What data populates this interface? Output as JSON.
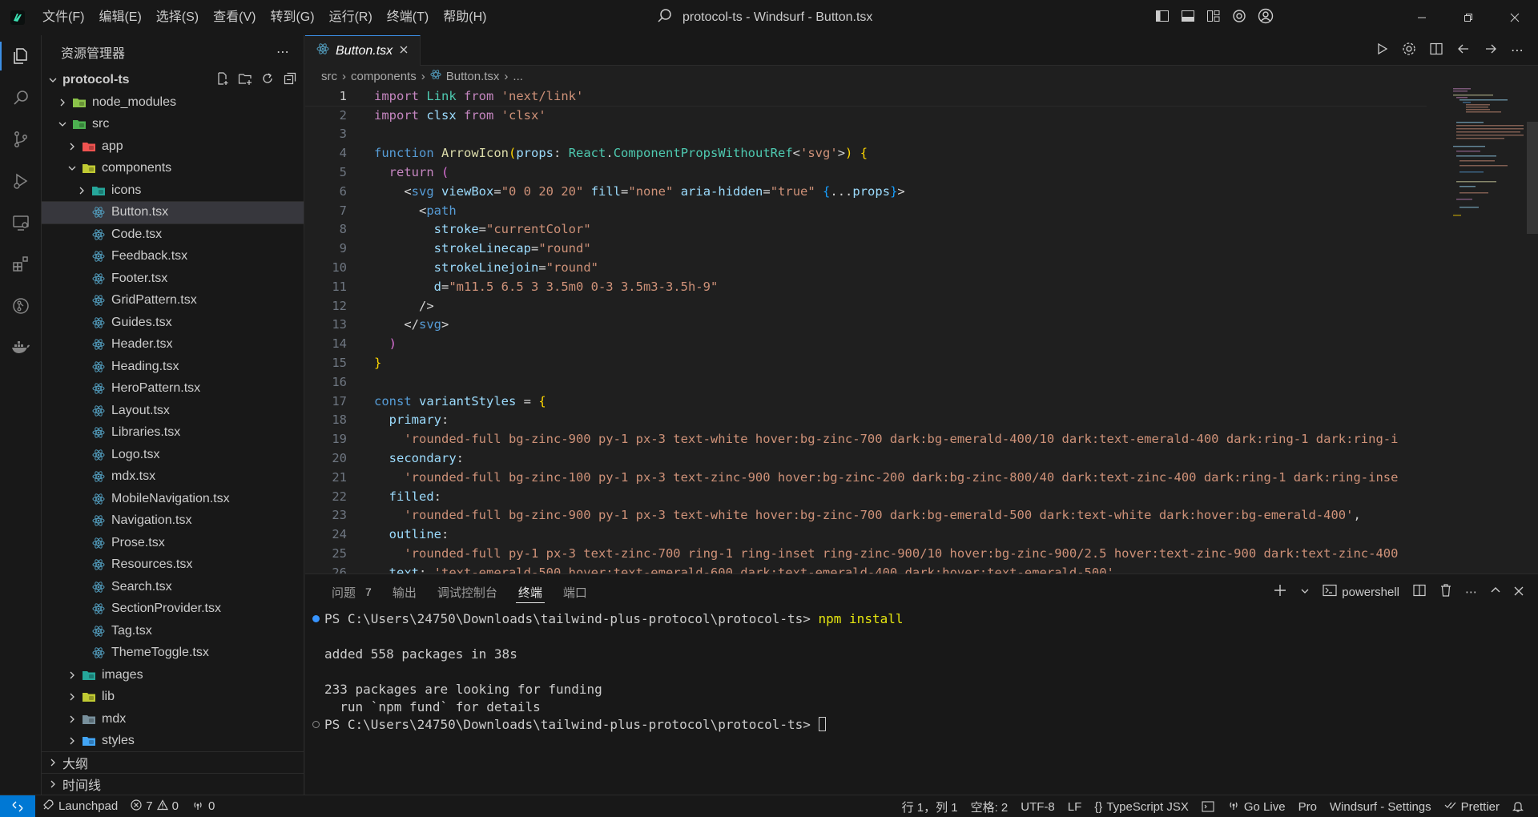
{
  "window": {
    "title": "protocol-ts - Windsurf - Button.tsx",
    "menu": [
      "文件(F)",
      "编辑(E)",
      "选择(S)",
      "查看(V)",
      "转到(G)",
      "运行(R)",
      "终端(T)",
      "帮助(H)"
    ]
  },
  "sidebar": {
    "title": "资源管理器",
    "root": "protocol-ts",
    "tree": [
      {
        "label": "node_modules",
        "depth": 1,
        "type": "folder",
        "expanded": false,
        "icon": "node-folder-icon"
      },
      {
        "label": "src",
        "depth": 1,
        "type": "folder",
        "expanded": true,
        "icon": "src-folder-icon"
      },
      {
        "label": "app",
        "depth": 2,
        "type": "folder",
        "expanded": false,
        "icon": "app-folder-icon"
      },
      {
        "label": "components",
        "depth": 2,
        "type": "folder",
        "expanded": true,
        "icon": "components-folder-icon"
      },
      {
        "label": "icons",
        "depth": 3,
        "type": "folder",
        "expanded": false,
        "icon": "icons-folder-icon"
      },
      {
        "label": "Button.tsx",
        "depth": 3,
        "type": "file",
        "selected": true,
        "icon": "react-icon"
      },
      {
        "label": "Code.tsx",
        "depth": 3,
        "type": "file",
        "icon": "react-icon"
      },
      {
        "label": "Feedback.tsx",
        "depth": 3,
        "type": "file",
        "icon": "react-icon"
      },
      {
        "label": "Footer.tsx",
        "depth": 3,
        "type": "file",
        "icon": "react-icon"
      },
      {
        "label": "GridPattern.tsx",
        "depth": 3,
        "type": "file",
        "icon": "react-icon"
      },
      {
        "label": "Guides.tsx",
        "depth": 3,
        "type": "file",
        "icon": "react-icon"
      },
      {
        "label": "Header.tsx",
        "depth": 3,
        "type": "file",
        "icon": "react-icon"
      },
      {
        "label": "Heading.tsx",
        "depth": 3,
        "type": "file",
        "icon": "react-icon"
      },
      {
        "label": "HeroPattern.tsx",
        "depth": 3,
        "type": "file",
        "icon": "react-icon"
      },
      {
        "label": "Layout.tsx",
        "depth": 3,
        "type": "file",
        "icon": "react-icon"
      },
      {
        "label": "Libraries.tsx",
        "depth": 3,
        "type": "file",
        "icon": "react-icon"
      },
      {
        "label": "Logo.tsx",
        "depth": 3,
        "type": "file",
        "icon": "react-icon"
      },
      {
        "label": "mdx.tsx",
        "depth": 3,
        "type": "file",
        "icon": "react-icon"
      },
      {
        "label": "MobileNavigation.tsx",
        "depth": 3,
        "type": "file",
        "icon": "react-icon"
      },
      {
        "label": "Navigation.tsx",
        "depth": 3,
        "type": "file",
        "icon": "react-icon"
      },
      {
        "label": "Prose.tsx",
        "depth": 3,
        "type": "file",
        "icon": "react-icon"
      },
      {
        "label": "Resources.tsx",
        "depth": 3,
        "type": "file",
        "icon": "react-icon"
      },
      {
        "label": "Search.tsx",
        "depth": 3,
        "type": "file",
        "icon": "react-icon"
      },
      {
        "label": "SectionProvider.tsx",
        "depth": 3,
        "type": "file",
        "icon": "react-icon"
      },
      {
        "label": "Tag.tsx",
        "depth": 3,
        "type": "file",
        "icon": "react-icon"
      },
      {
        "label": "ThemeToggle.tsx",
        "depth": 3,
        "type": "file",
        "icon": "react-icon"
      },
      {
        "label": "images",
        "depth": 2,
        "type": "folder",
        "expanded": false,
        "icon": "images-folder-icon"
      },
      {
        "label": "lib",
        "depth": 2,
        "type": "folder",
        "expanded": false,
        "icon": "lib-folder-icon"
      },
      {
        "label": "mdx",
        "depth": 2,
        "type": "folder",
        "expanded": false,
        "icon": "mdx-folder-icon"
      },
      {
        "label": "styles",
        "depth": 2,
        "type": "folder",
        "expanded": false,
        "icon": "styles-folder-icon"
      }
    ],
    "outline_label": "大纲",
    "timeline_label": "时间线"
  },
  "editor": {
    "tab_label": "Button.tsx",
    "breadcrumb": [
      "src",
      "components",
      "Button.tsx",
      "..."
    ],
    "current_line": 1,
    "lines": [
      [
        [
          "kw",
          "import"
        ],
        [
          "op",
          " "
        ],
        [
          "cls",
          "Link"
        ],
        [
          "op",
          " "
        ],
        [
          "kw",
          "from"
        ],
        [
          "op",
          " "
        ],
        [
          "str",
          "'next/link'"
        ]
      ],
      [
        [
          "kw",
          "import"
        ],
        [
          "op",
          " "
        ],
        [
          "var",
          "clsx"
        ],
        [
          "op",
          " "
        ],
        [
          "kw",
          "from"
        ],
        [
          "op",
          " "
        ],
        [
          "str",
          "'clsx'"
        ]
      ],
      [],
      [
        [
          "kb",
          "function"
        ],
        [
          "op",
          " "
        ],
        [
          "fn",
          "ArrowIcon"
        ],
        [
          "brk",
          "("
        ],
        [
          "var",
          "props"
        ],
        [
          "op",
          ": "
        ],
        [
          "cls",
          "React"
        ],
        [
          "op",
          "."
        ],
        [
          "cls",
          "ComponentPropsWithoutRef"
        ],
        [
          "op",
          "<"
        ],
        [
          "str",
          "'svg'"
        ],
        [
          "op",
          ">"
        ],
        [
          "brk",
          ")"
        ],
        [
          "op",
          " "
        ],
        [
          "brk",
          "{"
        ]
      ],
      [
        [
          "op",
          "  "
        ],
        [
          "kw",
          "return"
        ],
        [
          "op",
          " "
        ],
        [
          "pl",
          "("
        ]
      ],
      [
        [
          "op",
          "    "
        ],
        [
          "op",
          "<"
        ],
        [
          "tag",
          "svg"
        ],
        [
          "op",
          " "
        ],
        [
          "var",
          "viewBox"
        ],
        [
          "op",
          "="
        ],
        [
          "str",
          "\"0 0 20 20\""
        ],
        [
          "op",
          " "
        ],
        [
          "var",
          "fill"
        ],
        [
          "op",
          "="
        ],
        [
          "str",
          "\"none\""
        ],
        [
          "op",
          " "
        ],
        [
          "var",
          "aria-hidden"
        ],
        [
          "op",
          "="
        ],
        [
          "str",
          "\"true\""
        ],
        [
          "op",
          " "
        ],
        [
          "bl",
          "{"
        ],
        [
          "op",
          "..."
        ],
        [
          "var",
          "props"
        ],
        [
          "bl",
          "}"
        ],
        [
          "op",
          ">"
        ]
      ],
      [
        [
          "op",
          "      "
        ],
        [
          "op",
          "<"
        ],
        [
          "tag",
          "path"
        ]
      ],
      [
        [
          "op",
          "        "
        ],
        [
          "var",
          "stroke"
        ],
        [
          "op",
          "="
        ],
        [
          "str",
          "\"currentColor\""
        ]
      ],
      [
        [
          "op",
          "        "
        ],
        [
          "var",
          "strokeLinecap"
        ],
        [
          "op",
          "="
        ],
        [
          "str",
          "\"round\""
        ]
      ],
      [
        [
          "op",
          "        "
        ],
        [
          "var",
          "strokeLinejoin"
        ],
        [
          "op",
          "="
        ],
        [
          "str",
          "\"round\""
        ]
      ],
      [
        [
          "op",
          "        "
        ],
        [
          "var",
          "d"
        ],
        [
          "op",
          "="
        ],
        [
          "str",
          "\"m11.5 6.5 3 3.5m0 0-3 3.5m3-3.5h-9\""
        ]
      ],
      [
        [
          "op",
          "      "
        ],
        [
          "op",
          "/>"
        ]
      ],
      [
        [
          "op",
          "    "
        ],
        [
          "op",
          "</"
        ],
        [
          "tag",
          "svg"
        ],
        [
          "op",
          ">"
        ]
      ],
      [
        [
          "op",
          "  "
        ],
        [
          "pl",
          ")"
        ]
      ],
      [
        [
          "brk",
          "}"
        ]
      ],
      [],
      [
        [
          "kb",
          "const"
        ],
        [
          "op",
          " "
        ],
        [
          "var",
          "variantStyles"
        ],
        [
          "op",
          " = "
        ],
        [
          "brk",
          "{"
        ]
      ],
      [
        [
          "op",
          "  "
        ],
        [
          "var",
          "primary"
        ],
        [
          "op",
          ":"
        ]
      ],
      [
        [
          "op",
          "    "
        ],
        [
          "str",
          "'rounded-full bg-zinc-900 py-1 px-3 text-white hover:bg-zinc-700 dark:bg-emerald-400/10 dark:text-emerald-400 dark:ring-1 dark:ring-i"
        ]
      ],
      [
        [
          "op",
          "  "
        ],
        [
          "var",
          "secondary"
        ],
        [
          "op",
          ":"
        ]
      ],
      [
        [
          "op",
          "    "
        ],
        [
          "str",
          "'rounded-full bg-zinc-100 py-1 px-3 text-zinc-900 hover:bg-zinc-200 dark:bg-zinc-800/40 dark:text-zinc-400 dark:ring-1 dark:ring-inse"
        ]
      ],
      [
        [
          "op",
          "  "
        ],
        [
          "var",
          "filled"
        ],
        [
          "op",
          ":"
        ]
      ],
      [
        [
          "op",
          "    "
        ],
        [
          "str",
          "'rounded-full bg-zinc-900 py-1 px-3 text-white hover:bg-zinc-700 dark:bg-emerald-500 dark:text-white dark:hover:bg-emerald-400'"
        ],
        [
          "op",
          ","
        ]
      ],
      [
        [
          "op",
          "  "
        ],
        [
          "var",
          "outline"
        ],
        [
          "op",
          ":"
        ]
      ],
      [
        [
          "op",
          "    "
        ],
        [
          "str",
          "'rounded-full py-1 px-3 text-zinc-700 ring-1 ring-inset ring-zinc-900/10 hover:bg-zinc-900/2.5 hover:text-zinc-900 dark:text-zinc-400"
        ]
      ],
      [
        [
          "op",
          "  "
        ],
        [
          "var",
          "text"
        ],
        [
          "op",
          ": "
        ],
        [
          "str",
          "'text-emerald-500 hover:text-emerald-600 dark:text-emerald-400 dark:hover:text-emerald-500'"
        ],
        [
          "op",
          ","
        ]
      ]
    ]
  },
  "panel": {
    "tabs": [
      {
        "label": "问题",
        "count": "7"
      },
      {
        "label": "输出"
      },
      {
        "label": "调试控制台"
      },
      {
        "label": "终端",
        "active": true
      },
      {
        "label": "端口"
      }
    ],
    "shell_label": "powershell",
    "terminal": {
      "prompt": "PS C:\\Users\\24750\\Downloads\\tailwind-plus-protocol\\protocol-ts>",
      "command": "npm install",
      "output_1": "added 558 packages in 38s",
      "output_2": "233 packages are looking for funding",
      "output_3": "  run `npm fund` for details",
      "prompt_2": "PS C:\\Users\\24750\\Downloads\\tailwind-plus-protocol\\protocol-ts>"
    }
  },
  "statusbar": {
    "launchpad": "Launchpad",
    "errors": "7",
    "warnings": "0",
    "ports": "0",
    "position": "行 1，列 1",
    "spaces": "空格: 2",
    "encoding": "UTF-8",
    "eol": "LF",
    "language": "TypeScript JSX",
    "golive": "Go Live",
    "pro": "Pro",
    "settings": "Windsurf - Settings",
    "prettier": "Prettier"
  },
  "colors": {
    "accent": "#0078d4",
    "selection": "#37373d",
    "string": "#ce9178",
    "keyword": "#c586c0"
  }
}
